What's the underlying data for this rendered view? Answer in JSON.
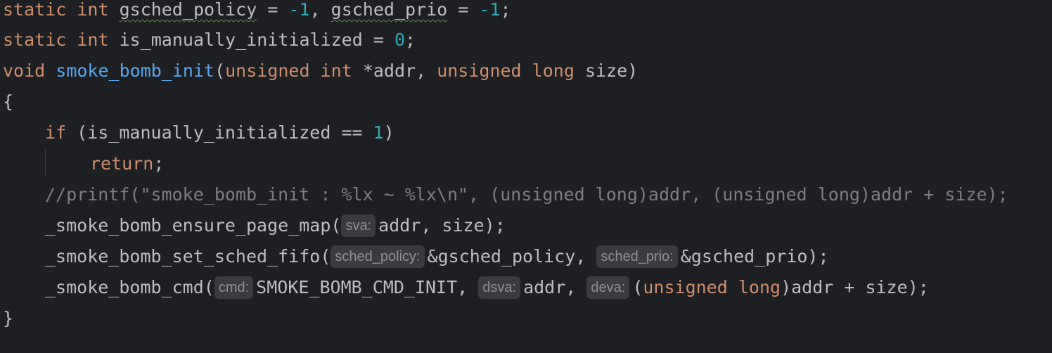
{
  "code": {
    "l1": {
      "kw1": "static",
      "kw2": "int",
      "v1": "gsched_policy",
      "op1": " = ",
      "n1": "-1",
      "sep": ", ",
      "v2": "gsched_prio",
      "op2": " = ",
      "n2": "-1",
      "end": ";"
    },
    "l2": {
      "kw1": "static",
      "kw2": "int",
      "v1": "is_manually_initialized",
      "op": " = ",
      "n": "0",
      "end": ";"
    },
    "l3": {
      "kw1": "void",
      "fn": "smoke_bomb_init",
      "p1": "(",
      "kw2": "unsigned",
      "kw3": "int",
      "a1": " *addr, ",
      "kw4": "unsigned",
      "kw5": "long",
      "a2": " size)"
    },
    "l4": {
      "brace": "{"
    },
    "l5": {
      "kw": "if",
      "cond": " (is_manually_initialized == ",
      "n": "1",
      "end": ")"
    },
    "l6": {
      "kw": "return",
      "end": ";"
    },
    "l7": {
      "comment": "//printf(\"smoke_bomb_init : %lx ~ %lx\\n\", (unsigned long)addr, (unsigned long)addr + size);"
    },
    "l8": {
      "call": "_smoke_bomb_ensure_page_map(",
      "hint1": "sva:",
      "rest": "addr, size);"
    },
    "l9": {
      "call": "_smoke_bomb_set_sched_fifo(",
      "hint1": "sched_policy:",
      "a1": "&gsched_policy, ",
      "hint2": "sched_prio:",
      "a2": "&gsched_prio);"
    },
    "l10": {
      "call": "_smoke_bomb_cmd(",
      "hint1": "cmd:",
      "a1": "SMOKE_BOMB_CMD_INIT, ",
      "hint2": "dsva:",
      "a2": "addr, ",
      "hint3": "deva:",
      "p": "(",
      "kw1": "unsigned",
      "kw2": "long",
      "a3": ")addr + size);"
    },
    "l11": {
      "brace": "}"
    }
  },
  "colors": {
    "background": "#1e1f22",
    "keyword": "#cf8e6d",
    "number": "#2aacb8",
    "function": "#56a8f5",
    "comment": "#7a7e85",
    "text": "#bcbec4",
    "hint_bg": "#393b40"
  }
}
